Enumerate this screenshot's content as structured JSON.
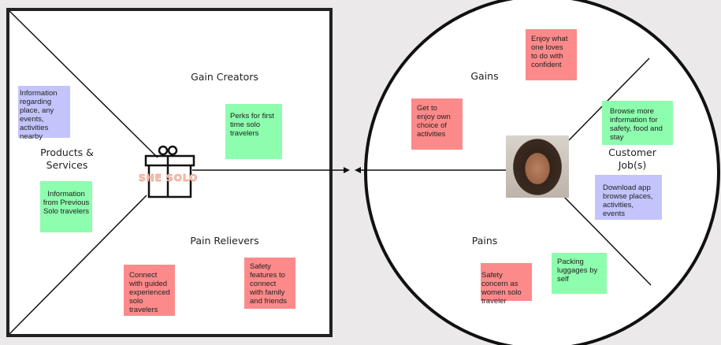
{
  "value_map": {
    "brand": "She Solo",
    "sections": {
      "gain_creators": "Gain Creators",
      "products_services": "Products & Services",
      "pain_relievers": "Pain Relievers"
    },
    "notes": [
      {
        "text": "Information regarding place, any events, activities nearby",
        "color": "#c3c4fb"
      },
      {
        "text": "Information from Previous Solo travelers",
        "color": "#8dfdae"
      },
      {
        "text": "Perks for first time solo travelers",
        "color": "#8dfdae"
      },
      {
        "text": "Connect with guided experienced solo travelers",
        "color": "#fd8a8a"
      },
      {
        "text": "Safety features to connect with family and friends",
        "color": "#fd8a8a"
      }
    ]
  },
  "customer_profile": {
    "sections": {
      "gains": "Gains",
      "customer_jobs": "Customer Job(s)",
      "pains": "Pains"
    },
    "notes": [
      {
        "text": "Enjoy what one loves to do with confident",
        "color": "#fd8a8a"
      },
      {
        "text": "Get to enjoy own choice of activities",
        "color": "#fd8a8a"
      },
      {
        "text": "Browse more information for safety, food and stay",
        "color": "#8dfdae"
      },
      {
        "text": "Download app browse places, activities, events",
        "color": "#c3c4fb"
      },
      {
        "text": "Packing luggages by self",
        "color": "#8dfdae"
      },
      {
        "text": "Safety concern as women solo traveler",
        "color": "#fd8a8a"
      }
    ]
  }
}
